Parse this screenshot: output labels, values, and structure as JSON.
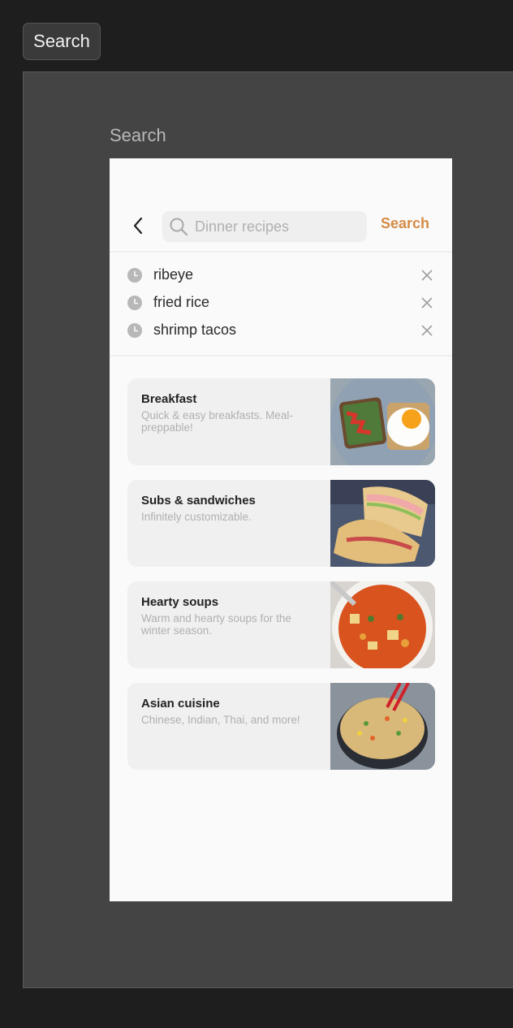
{
  "top_tab": {
    "label": "Search"
  },
  "frame": {
    "label": "Search"
  },
  "search": {
    "placeholder": "Dinner recipes",
    "value": "",
    "action_label": "Search"
  },
  "recent_searches": [
    {
      "label": "ribeye"
    },
    {
      "label": "fried rice"
    },
    {
      "label": "shrimp tacos"
    }
  ],
  "categories": [
    {
      "title": "Breakfast",
      "description": "Quick & easy breakfasts. Meal-preppable!",
      "image": "breakfast-toast-egg"
    },
    {
      "title": "Subs & sandwiches",
      "description": "Infinitely customizable.",
      "image": "sub-sandwich"
    },
    {
      "title": "Hearty soups",
      "description": "Warm and hearty soups for the winter season.",
      "image": "vegetable-soup"
    },
    {
      "title": "Asian cuisine",
      "description": "Chinese, Indian, Thai, and more!",
      "image": "fried-rice-bowl"
    }
  ],
  "colors": {
    "accent": "#d68a45",
    "app_bg": "#fafafa",
    "card_bg": "#f0f0f0",
    "canvas_bg": "#444444",
    "outer_bg": "#1e1e1e"
  }
}
